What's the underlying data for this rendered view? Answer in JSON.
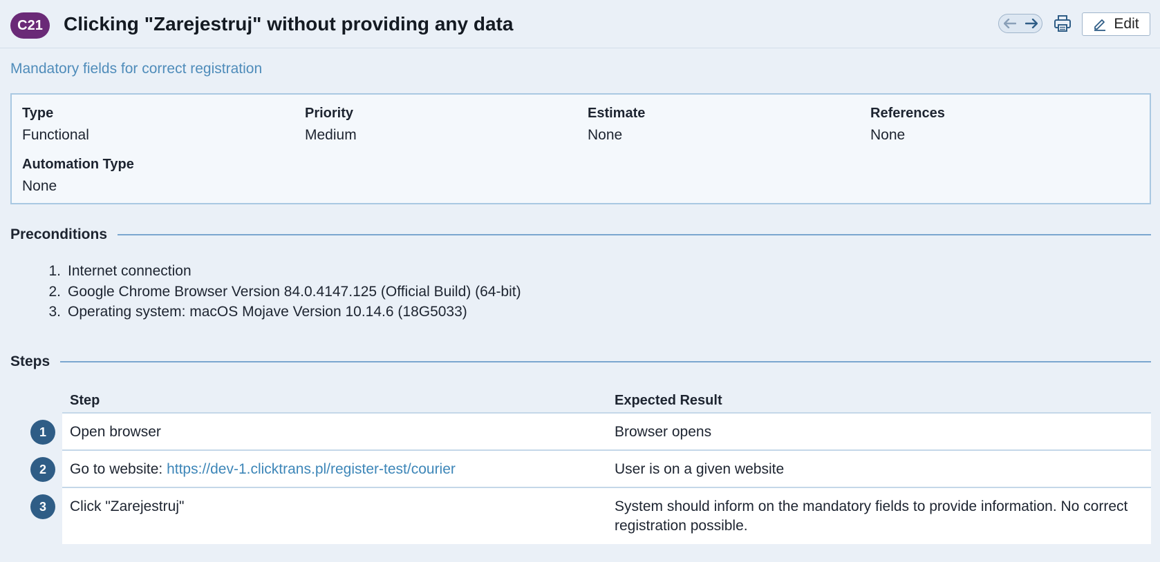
{
  "header": {
    "case_id": "C21",
    "title": "Clicking \"Zarejestruj\" without providing any data",
    "edit_label": "Edit"
  },
  "subtitle": "Mandatory fields for correct registration",
  "properties": [
    {
      "label": "Type",
      "value": "Functional"
    },
    {
      "label": "Priority",
      "value": "Medium"
    },
    {
      "label": "Estimate",
      "value": "None"
    },
    {
      "label": "References",
      "value": "None"
    },
    {
      "label": "Automation Type",
      "value": "None"
    }
  ],
  "preconditions": {
    "title": "Preconditions",
    "items": [
      {
        "num": "1.",
        "text": "Internet connection"
      },
      {
        "num": "2.",
        "text": "Google Chrome Browser Version 84.0.4147.125 (Official Build) (64-bit)"
      },
      {
        "num": "3.",
        "text": "Operating system: macOS Mojave Version 10.14.6 (18G5033)"
      }
    ]
  },
  "steps": {
    "title": "Steps",
    "col_step": "Step",
    "col_expected": "Expected Result",
    "rows": [
      {
        "num": "1",
        "step": "Open browser",
        "expected": "Browser opens"
      },
      {
        "num": "2",
        "step_prefix": "Go to website: ",
        "step_link": "https://dev-1.clicktrans.pl/register-test/courier",
        "expected": "User is on a given website"
      },
      {
        "num": "3",
        "step": "Click \"Zarejestruj\"",
        "expected_line1": "System should inform on the mandatory fields to provide information. No correct",
        "expected_line2": "registration possible."
      }
    ]
  }
}
